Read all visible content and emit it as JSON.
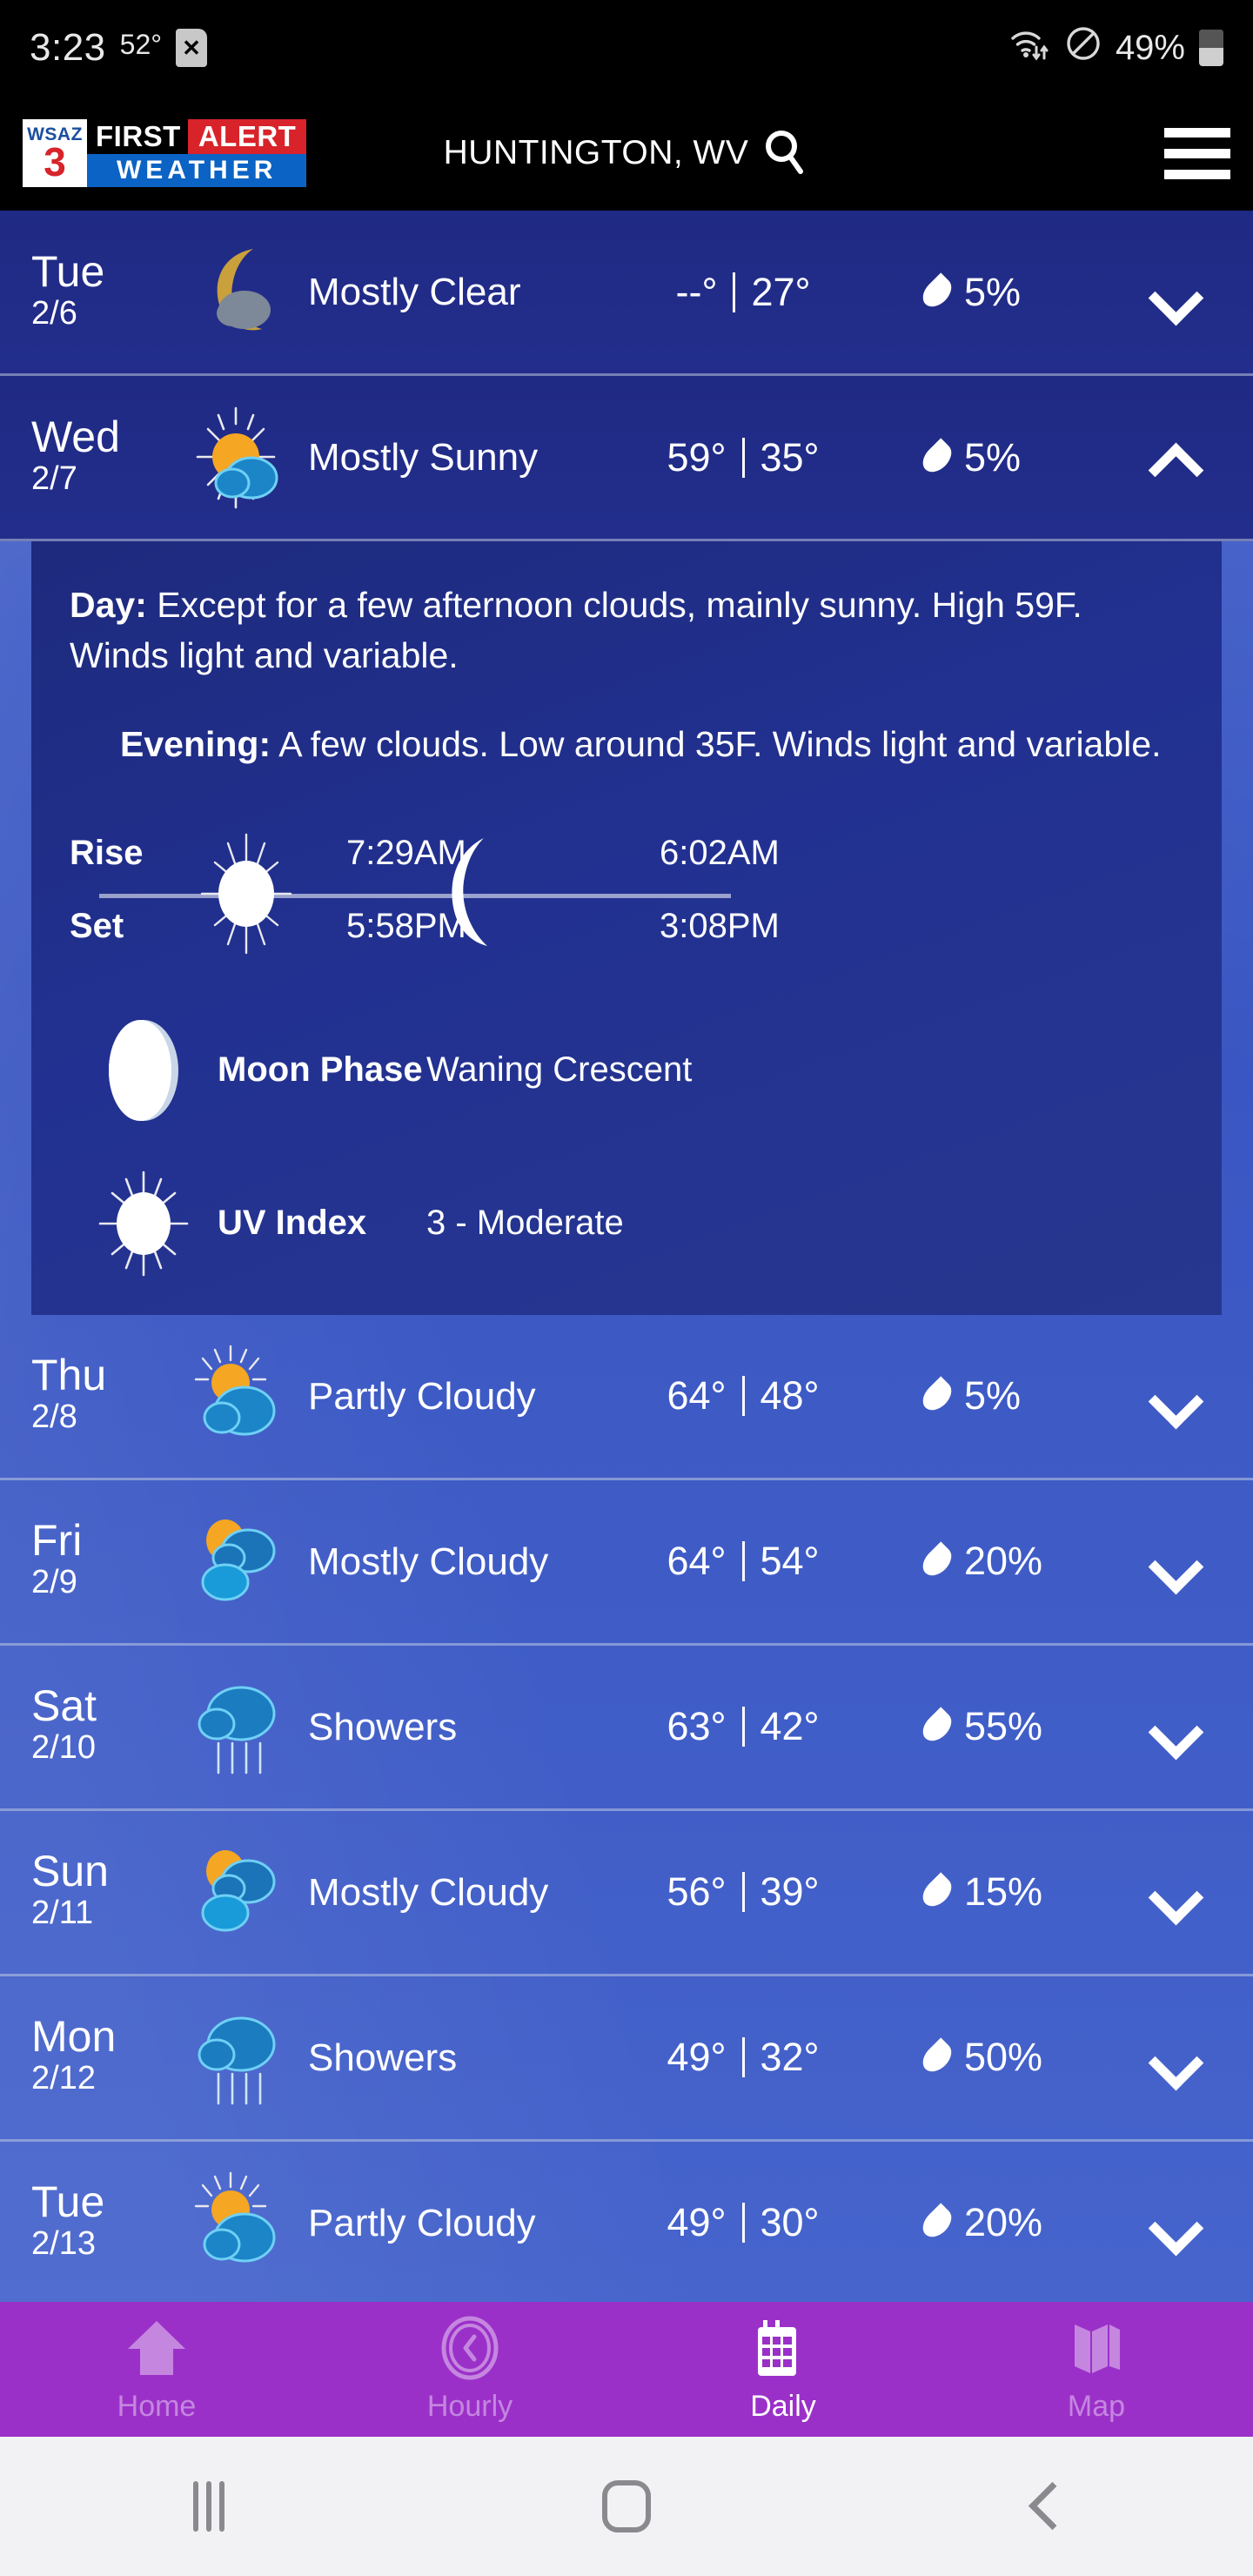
{
  "status_bar": {
    "time": "3:23",
    "temperature": "52°",
    "sim_icon": "sim-card-x-icon",
    "wifi_icon": "wifi-transfer-icon",
    "dnd_icon": "do-not-disturb-icon",
    "battery_percent": "49%",
    "battery_level": 49
  },
  "header": {
    "logo": {
      "station": "WSAZ",
      "channel": "3",
      "first": "FIRST",
      "alert": "ALERT",
      "weather": "WEATHER"
    },
    "location": "HUNTINGTON, WV",
    "search_icon": "search-icon",
    "menu_icon": "hamburger-menu-icon"
  },
  "forecast": {
    "days": [
      {
        "name": "Tue",
        "date": "2/6",
        "icon": "moon-cloud-icon",
        "condition": "Mostly Clear",
        "high": "--°",
        "low": "27°",
        "precip": "5%",
        "expanded": false,
        "theme": "dark"
      },
      {
        "name": "Wed",
        "date": "2/7",
        "icon": "sun-cloud-icon",
        "condition": "Mostly Sunny",
        "high": "59°",
        "low": "35°",
        "precip": "5%",
        "expanded": true,
        "theme": "dark"
      },
      {
        "name": "Thu",
        "date": "2/8",
        "icon": "sun-behind-cloud-icon",
        "condition": "Partly Cloudy",
        "high": "64°",
        "low": "48°",
        "precip": "5%",
        "expanded": false,
        "theme": "light"
      },
      {
        "name": "Fri",
        "date": "2/9",
        "icon": "sun-two-clouds-icon",
        "condition": "Mostly Cloudy",
        "high": "64°",
        "low": "54°",
        "precip": "20%",
        "expanded": false,
        "theme": "light"
      },
      {
        "name": "Sat",
        "date": "2/10",
        "icon": "rain-cloud-icon",
        "condition": "Showers",
        "high": "63°",
        "low": "42°",
        "precip": "55%",
        "expanded": false,
        "theme": "light"
      },
      {
        "name": "Sun",
        "date": "2/11",
        "icon": "sun-two-clouds-icon",
        "condition": "Mostly Cloudy",
        "high": "56°",
        "low": "39°",
        "precip": "15%",
        "expanded": false,
        "theme": "light"
      },
      {
        "name": "Mon",
        "date": "2/12",
        "icon": "rain-cloud-icon",
        "condition": "Showers",
        "high": "49°",
        "low": "32°",
        "precip": "50%",
        "expanded": false,
        "theme": "light"
      },
      {
        "name": "Tue",
        "date": "2/13",
        "icon": "sun-behind-cloud-icon",
        "condition": "Partly Cloudy",
        "high": "49°",
        "low": "30°",
        "precip": "20%",
        "expanded": false,
        "theme": "light"
      }
    ]
  },
  "detail": {
    "day_label": "Day:",
    "day_text": " Except for a few afternoon clouds, mainly sunny. High 59F. Winds light and variable.",
    "evening_label": "Evening:",
    "evening_text": " A few clouds. Low around 35F. Winds light and variable.",
    "rise_label": "Rise",
    "set_label": "Set",
    "sunrise": "7:29AM",
    "sunset": "5:58PM",
    "moonrise": "6:02AM",
    "moonset": "3:08PM",
    "moon_phase_label": "Moon Phase",
    "moon_phase_value": "Waning Crescent",
    "uv_label": "UV Index",
    "uv_value": "3 - Moderate"
  },
  "bottom_nav": {
    "items": [
      {
        "label": "Home",
        "icon": "home-icon",
        "active": false
      },
      {
        "label": "Hourly",
        "icon": "clock-icon",
        "active": false
      },
      {
        "label": "Daily",
        "icon": "calendar-icon",
        "active": true
      },
      {
        "label": "Map",
        "icon": "map-icon",
        "active": false
      }
    ]
  },
  "system_nav": {
    "recents_icon": "recents-icon",
    "home_icon": "home-pill-icon",
    "back_icon": "back-chevron-icon"
  },
  "colors": {
    "accent_purple": "#9b30c9",
    "row_dark": "#1f2a84",
    "row_light": "#3f5ec9",
    "alert_red": "#d8232a",
    "logo_blue": "#0b63c5"
  }
}
